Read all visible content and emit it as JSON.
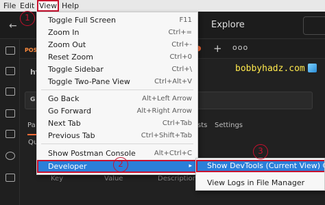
{
  "menubar": {
    "items": [
      "File",
      "Edit",
      "View",
      "Help"
    ]
  },
  "header": {
    "explore": "Explore"
  },
  "tabs": {
    "post_tab": "POST",
    "plus": "+",
    "more": "ooo"
  },
  "workspace": {
    "watermark": "bobbyhadz.com",
    "frag_ht": "ht",
    "frag_g": "G",
    "frag_pa": "Pa",
    "frag_q": "Qu",
    "frag_sts": "sts",
    "settings": "Settings",
    "columns": [
      "Key",
      "Value",
      "Description"
    ]
  },
  "view_menu": {
    "items": [
      {
        "label": "Toggle Full Screen",
        "shortcut": "F11"
      },
      {
        "label": "Zoom In",
        "shortcut": "Ctrl+="
      },
      {
        "label": "Zoom Out",
        "shortcut": "Ctrl+-"
      },
      {
        "label": "Reset Zoom",
        "shortcut": "Ctrl+0"
      },
      {
        "label": "Toggle Sidebar",
        "shortcut": "Ctrl+\\"
      },
      {
        "label": "Toggle Two-Pane View",
        "shortcut": "Ctrl+Alt+V"
      },
      {
        "label": "Go Back",
        "shortcut": "Alt+Left Arrow"
      },
      {
        "label": "Go Forward",
        "shortcut": "Alt+Right Arrow"
      },
      {
        "label": "Next Tab",
        "shortcut": "Ctrl+Tab"
      },
      {
        "label": "Previous Tab",
        "shortcut": "Ctrl+Shift+Tab"
      },
      {
        "label": "Show Postman Console",
        "shortcut": "Alt+Ctrl+C"
      },
      {
        "label": "Developer",
        "shortcut": "▸"
      }
    ]
  },
  "developer_submenu": {
    "items": [
      {
        "label": "Show DevTools (Current View)  Ctrl"
      },
      {
        "label": "View Logs in File Manager"
      }
    ]
  },
  "steps": [
    "1",
    "2",
    "3"
  ],
  "colors": {
    "highlight": "#2b7fd9",
    "annotation": "#c8102e",
    "accent": "#ff6c37",
    "watermark": "#ffe94d"
  }
}
